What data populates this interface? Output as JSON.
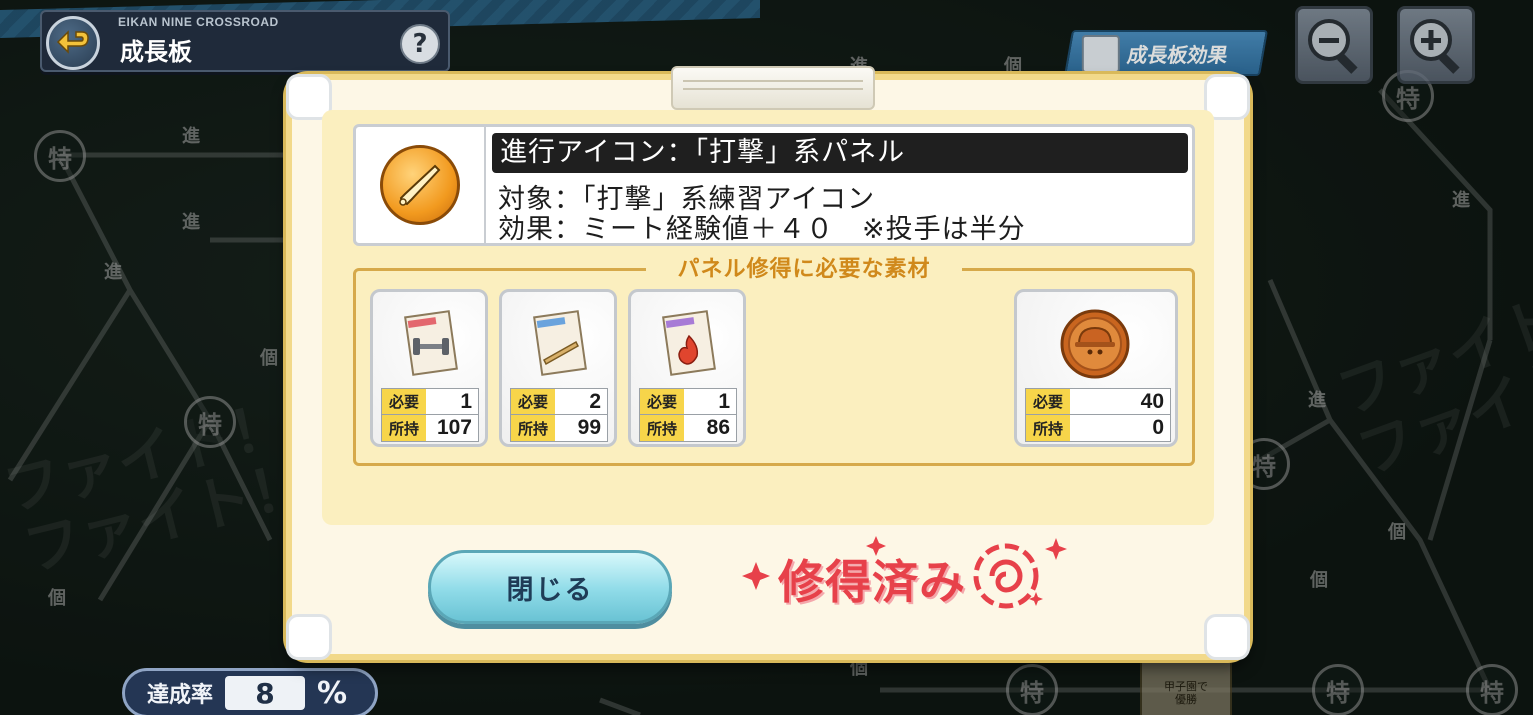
{
  "header": {
    "subtitle": "EIKAN NINE CROSSROAD",
    "title": "成長板",
    "help_label": "?",
    "effect_button_label": "成長板効果"
  },
  "board": {
    "node_labels": [
      "特",
      "特",
      "特",
      "特",
      "特",
      "特",
      "特"
    ],
    "small_labels": [
      "進",
      "進",
      "進",
      "個",
      "個",
      "進",
      "進",
      "進",
      "個",
      "個",
      "個",
      "個"
    ],
    "chalk_texts": [
      "ファイト！",
      "ファイト！",
      "ファイト！",
      "ファイト！"
    ],
    "koshien_card": "甲子園で\n優勝"
  },
  "achievement": {
    "label": "達成率",
    "value": "8",
    "unit": "%"
  },
  "dialog": {
    "title": "進行アイコン：「打撃」系パネル",
    "target_line": "対象：「打撃」系練習アイコン",
    "effect_line": "効果：ミート経験値＋４０　※投手は半分",
    "icon_name": "bat-icon",
    "materials_heading": "パネル修得に必要な素材",
    "required_label": "必要",
    "owned_label": "所持",
    "materials": [
      {
        "name": "training-dumbbell",
        "required": "1",
        "owned": "107"
      },
      {
        "name": "training-bat",
        "required": "2",
        "owned": "99"
      },
      {
        "name": "training-fire",
        "required": "1",
        "owned": "86"
      },
      {
        "name": "coin",
        "required": "40",
        "owned": "0"
      }
    ],
    "close_label": "閉じる",
    "status_stamp": "修得済み"
  },
  "colors": {
    "accent_orange": "#d0891b",
    "stamp_red": "#e7414a",
    "button_cyan": "#8fdbe8",
    "dialog_bg": "#fdf7e6",
    "label_yellow": "#f7d54a"
  }
}
